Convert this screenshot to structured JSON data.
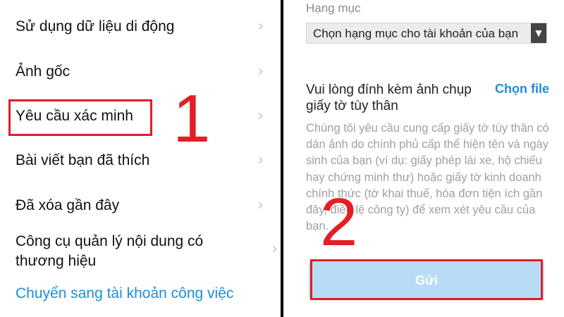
{
  "menu": {
    "items": [
      {
        "label": "Sử dụng dữ liệu di động"
      },
      {
        "label": "Ảnh gốc"
      },
      {
        "label": "Yêu cầu xác minh"
      },
      {
        "label": "Bài viết bạn đã thích"
      },
      {
        "label": "Đã xóa gần đây"
      },
      {
        "label": "Công cụ quản lý nội dung có thương hiệu"
      }
    ],
    "switch_link": "Chuyển sang tài khoản công việc",
    "chevron": "›"
  },
  "annotations": {
    "step1": "1",
    "step2": "2",
    "color": "#e31e24"
  },
  "form": {
    "category_label": "Hạng mục",
    "category_value": "Chọn hạng mục cho tài khoản của bạn",
    "dropdown_arrow": "▼",
    "attach_title": "Vui lòng đính kèm ảnh chụp giấy tờ tùy thân",
    "choose_file": "Chọn file",
    "description": "Chúng tôi yêu cầu cung cấp giấy tờ tùy thân có dán ảnh do chính phủ cấp thể hiện tên và ngày sinh của bạn (ví dụ: giấy phép lái xe, hộ chiếu hay chứng minh thư) hoặc giấy tờ kinh doanh chính thức (tờ khai thuế, hóa đơn tiện ích gần đây, điều lệ công ty) để xem xét yêu cầu của bạn.",
    "submit": "Gửi"
  },
  "colors": {
    "link": "#1a8fe0",
    "submit_bg": "#b8dcf6"
  }
}
